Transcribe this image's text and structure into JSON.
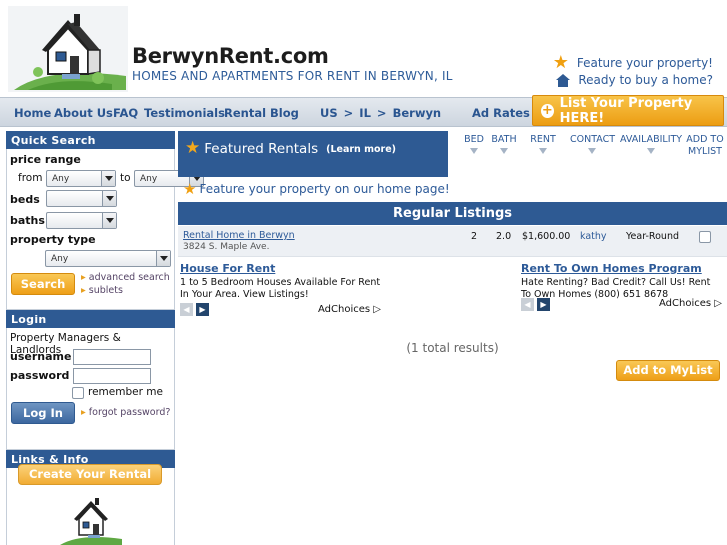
{
  "header": {
    "site_name": "BerwynRent.com",
    "tagline": "HOMES AND APARTMENTS FOR RENT IN BERWYN, IL",
    "feature_link": "Feature your property!",
    "buy_link": "Ready to buy a home?"
  },
  "nav": {
    "items": [
      "Home",
      "About Us",
      "FAQ",
      "Testimonials",
      "Rental Blog"
    ],
    "breadcrumb": [
      "US",
      "IL",
      "Berwyn"
    ],
    "breadcrumb_sep": ">",
    "ad_rates": "Ad Rates",
    "list_property": "List Your Property HERE!"
  },
  "quick_search": {
    "heading": "Quick Search",
    "price_range_label": "price range",
    "from_label": "from",
    "to_label": "to",
    "price_from": "Any",
    "price_to": "Any",
    "beds_label": "beds",
    "baths_label": "baths",
    "property_type_label": "property type",
    "property_type": "Any",
    "search_button": "Search",
    "advanced_search": "advanced search",
    "sublets": "sublets"
  },
  "login": {
    "heading": "Login",
    "subheading": "Property Managers & Landlords",
    "username_label": "username",
    "password_label": "password",
    "remember_me": "remember me",
    "login_button": "Log In",
    "forgot_password": "forgot password?"
  },
  "links": {
    "heading": "Links & Info",
    "create_ad": "Create Your Rental Ad!"
  },
  "featured": {
    "title": "Featured Rentals",
    "learn_more": "(Learn more)",
    "columns": [
      "BED",
      "BATH",
      "RENT",
      "CONTACT",
      "AVAILABILITY",
      "ADD TO MYLIST"
    ],
    "feature_home": "Feature your property on our home page!"
  },
  "regular": {
    "heading": "Regular Listings",
    "listing": {
      "title": "Rental Home in Berwyn",
      "address": "3824 S. Maple Ave.",
      "bed": "2",
      "bath": "2.0",
      "rent": "$1,600.00",
      "contact": "kathy",
      "availability": "Year-Round"
    }
  },
  "ads": [
    {
      "title": "House For Rent",
      "text": "1 to 5 Bedroom Houses Available For Rent In Your Area. View Listings!",
      "choices": "AdChoices"
    },
    {
      "title": "Rent To Own Homes Program",
      "text": "Hate Renting? Bad Credit? Call Us! Rent To Own Homes (800) 651 8678",
      "choices": "AdChoices"
    }
  ],
  "results": {
    "count_text": "(1 total results)",
    "add_mylist": "Add to MyList"
  },
  "colors": {
    "brand_blue": "#2e5a93",
    "accent_orange": "#ee9f17",
    "link_blue": "#2d5a98"
  }
}
